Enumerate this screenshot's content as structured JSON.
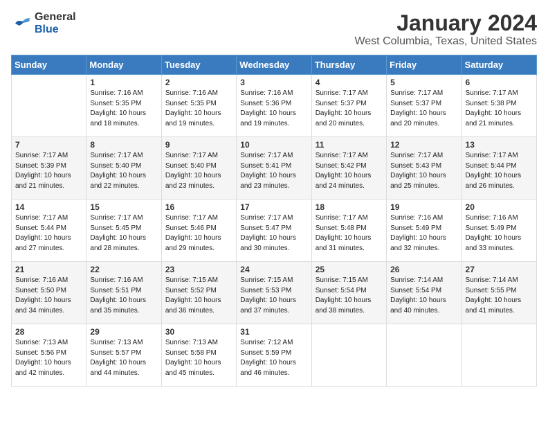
{
  "logo": {
    "general": "General",
    "blue": "Blue"
  },
  "title": "January 2024",
  "subtitle": "West Columbia, Texas, United States",
  "days_of_week": [
    "Sunday",
    "Monday",
    "Tuesday",
    "Wednesday",
    "Thursday",
    "Friday",
    "Saturday"
  ],
  "weeks": [
    [
      {
        "day": "",
        "info": ""
      },
      {
        "day": "1",
        "info": "Sunrise: 7:16 AM\nSunset: 5:35 PM\nDaylight: 10 hours\nand 18 minutes."
      },
      {
        "day": "2",
        "info": "Sunrise: 7:16 AM\nSunset: 5:35 PM\nDaylight: 10 hours\nand 19 minutes."
      },
      {
        "day": "3",
        "info": "Sunrise: 7:16 AM\nSunset: 5:36 PM\nDaylight: 10 hours\nand 19 minutes."
      },
      {
        "day": "4",
        "info": "Sunrise: 7:17 AM\nSunset: 5:37 PM\nDaylight: 10 hours\nand 20 minutes."
      },
      {
        "day": "5",
        "info": "Sunrise: 7:17 AM\nSunset: 5:37 PM\nDaylight: 10 hours\nand 20 minutes."
      },
      {
        "day": "6",
        "info": "Sunrise: 7:17 AM\nSunset: 5:38 PM\nDaylight: 10 hours\nand 21 minutes."
      }
    ],
    [
      {
        "day": "7",
        "info": "Sunrise: 7:17 AM\nSunset: 5:39 PM\nDaylight: 10 hours\nand 21 minutes."
      },
      {
        "day": "8",
        "info": "Sunrise: 7:17 AM\nSunset: 5:40 PM\nDaylight: 10 hours\nand 22 minutes."
      },
      {
        "day": "9",
        "info": "Sunrise: 7:17 AM\nSunset: 5:40 PM\nDaylight: 10 hours\nand 23 minutes."
      },
      {
        "day": "10",
        "info": "Sunrise: 7:17 AM\nSunset: 5:41 PM\nDaylight: 10 hours\nand 23 minutes."
      },
      {
        "day": "11",
        "info": "Sunrise: 7:17 AM\nSunset: 5:42 PM\nDaylight: 10 hours\nand 24 minutes."
      },
      {
        "day": "12",
        "info": "Sunrise: 7:17 AM\nSunset: 5:43 PM\nDaylight: 10 hours\nand 25 minutes."
      },
      {
        "day": "13",
        "info": "Sunrise: 7:17 AM\nSunset: 5:44 PM\nDaylight: 10 hours\nand 26 minutes."
      }
    ],
    [
      {
        "day": "14",
        "info": "Sunrise: 7:17 AM\nSunset: 5:44 PM\nDaylight: 10 hours\nand 27 minutes."
      },
      {
        "day": "15",
        "info": "Sunrise: 7:17 AM\nSunset: 5:45 PM\nDaylight: 10 hours\nand 28 minutes."
      },
      {
        "day": "16",
        "info": "Sunrise: 7:17 AM\nSunset: 5:46 PM\nDaylight: 10 hours\nand 29 minutes."
      },
      {
        "day": "17",
        "info": "Sunrise: 7:17 AM\nSunset: 5:47 PM\nDaylight: 10 hours\nand 30 minutes."
      },
      {
        "day": "18",
        "info": "Sunrise: 7:17 AM\nSunset: 5:48 PM\nDaylight: 10 hours\nand 31 minutes."
      },
      {
        "day": "19",
        "info": "Sunrise: 7:16 AM\nSunset: 5:49 PM\nDaylight: 10 hours\nand 32 minutes."
      },
      {
        "day": "20",
        "info": "Sunrise: 7:16 AM\nSunset: 5:49 PM\nDaylight: 10 hours\nand 33 minutes."
      }
    ],
    [
      {
        "day": "21",
        "info": "Sunrise: 7:16 AM\nSunset: 5:50 PM\nDaylight: 10 hours\nand 34 minutes."
      },
      {
        "day": "22",
        "info": "Sunrise: 7:16 AM\nSunset: 5:51 PM\nDaylight: 10 hours\nand 35 minutes."
      },
      {
        "day": "23",
        "info": "Sunrise: 7:15 AM\nSunset: 5:52 PM\nDaylight: 10 hours\nand 36 minutes."
      },
      {
        "day": "24",
        "info": "Sunrise: 7:15 AM\nSunset: 5:53 PM\nDaylight: 10 hours\nand 37 minutes."
      },
      {
        "day": "25",
        "info": "Sunrise: 7:15 AM\nSunset: 5:54 PM\nDaylight: 10 hours\nand 38 minutes."
      },
      {
        "day": "26",
        "info": "Sunrise: 7:14 AM\nSunset: 5:54 PM\nDaylight: 10 hours\nand 40 minutes."
      },
      {
        "day": "27",
        "info": "Sunrise: 7:14 AM\nSunset: 5:55 PM\nDaylight: 10 hours\nand 41 minutes."
      }
    ],
    [
      {
        "day": "28",
        "info": "Sunrise: 7:13 AM\nSunset: 5:56 PM\nDaylight: 10 hours\nand 42 minutes."
      },
      {
        "day": "29",
        "info": "Sunrise: 7:13 AM\nSunset: 5:57 PM\nDaylight: 10 hours\nand 44 minutes."
      },
      {
        "day": "30",
        "info": "Sunrise: 7:13 AM\nSunset: 5:58 PM\nDaylight: 10 hours\nand 45 minutes."
      },
      {
        "day": "31",
        "info": "Sunrise: 7:12 AM\nSunset: 5:59 PM\nDaylight: 10 hours\nand 46 minutes."
      },
      {
        "day": "",
        "info": ""
      },
      {
        "day": "",
        "info": ""
      },
      {
        "day": "",
        "info": ""
      }
    ]
  ]
}
